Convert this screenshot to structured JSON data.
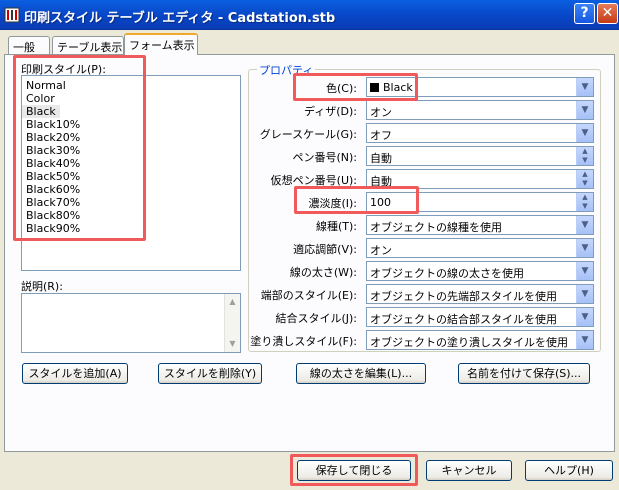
{
  "window": {
    "title": "印刷スタイル テーブル エディタ - Cadstation.stb",
    "help_glyph": "?",
    "close_glyph": "✕"
  },
  "tabs": [
    "一般",
    "テーブル表示",
    "フォーム表示"
  ],
  "styles": {
    "label": "印刷スタイル(P):",
    "items": [
      "Normal",
      "Color",
      "Black",
      "Black10%",
      "Black20%",
      "Black30%",
      "Black40%",
      "Black50%",
      "Black60%",
      "Black70%",
      "Black80%",
      "Black90%"
    ],
    "selected": "Black"
  },
  "description": {
    "label": "説明(R):",
    "value": ""
  },
  "properties": {
    "legend": "プロパティ",
    "rows": [
      {
        "label": "色(C):",
        "value": "Black",
        "control": "dropdown",
        "swatch": "#000000"
      },
      {
        "label": "ディザ(D):",
        "value": "オン",
        "control": "dropdown"
      },
      {
        "label": "グレースケール(G):",
        "value": "オフ",
        "control": "dropdown"
      },
      {
        "label": "ペン番号(N):",
        "value": "自動",
        "control": "spinner"
      },
      {
        "label": "仮想ペン番号(U):",
        "value": "自動",
        "control": "spinner"
      },
      {
        "label": "濃淡度(I):",
        "value": "100",
        "control": "spinner"
      },
      {
        "label": "線種(T):",
        "value": "オブジェクトの線種を使用",
        "control": "dropdown"
      },
      {
        "label": "適応調節(V):",
        "value": "オン",
        "control": "dropdown"
      },
      {
        "label": "線の太さ(W):",
        "value": "オブジェクトの線の太さを使用",
        "control": "dropdown"
      },
      {
        "label": "端部のスタイル(E):",
        "value": "オブジェクトの先端部スタイルを使用",
        "control": "dropdown"
      },
      {
        "label": "結合スタイル(J):",
        "value": "オブジェクトの結合部スタイルを使用",
        "control": "dropdown"
      },
      {
        "label": "塗り潰しスタイル(F):",
        "value": "オブジェクトの塗り潰しスタイルを使用",
        "control": "dropdown"
      }
    ]
  },
  "panel_buttons": {
    "add_style": "スタイルを追加(A)",
    "delete_style": "スタイルを削除(Y)",
    "edit_lineweights": "線の太さを編集(L)...",
    "save_as": "名前を付けて保存(S)..."
  },
  "footer": {
    "save_close": "保存して閉じる",
    "cancel": "キャンセル",
    "help": "ヘルプ(H)"
  },
  "colors": {
    "titlebar": "#0a5fe0",
    "dialog_bg": "#ece9d8",
    "legend": "#0046d5",
    "highlight": "#f05a5a"
  }
}
